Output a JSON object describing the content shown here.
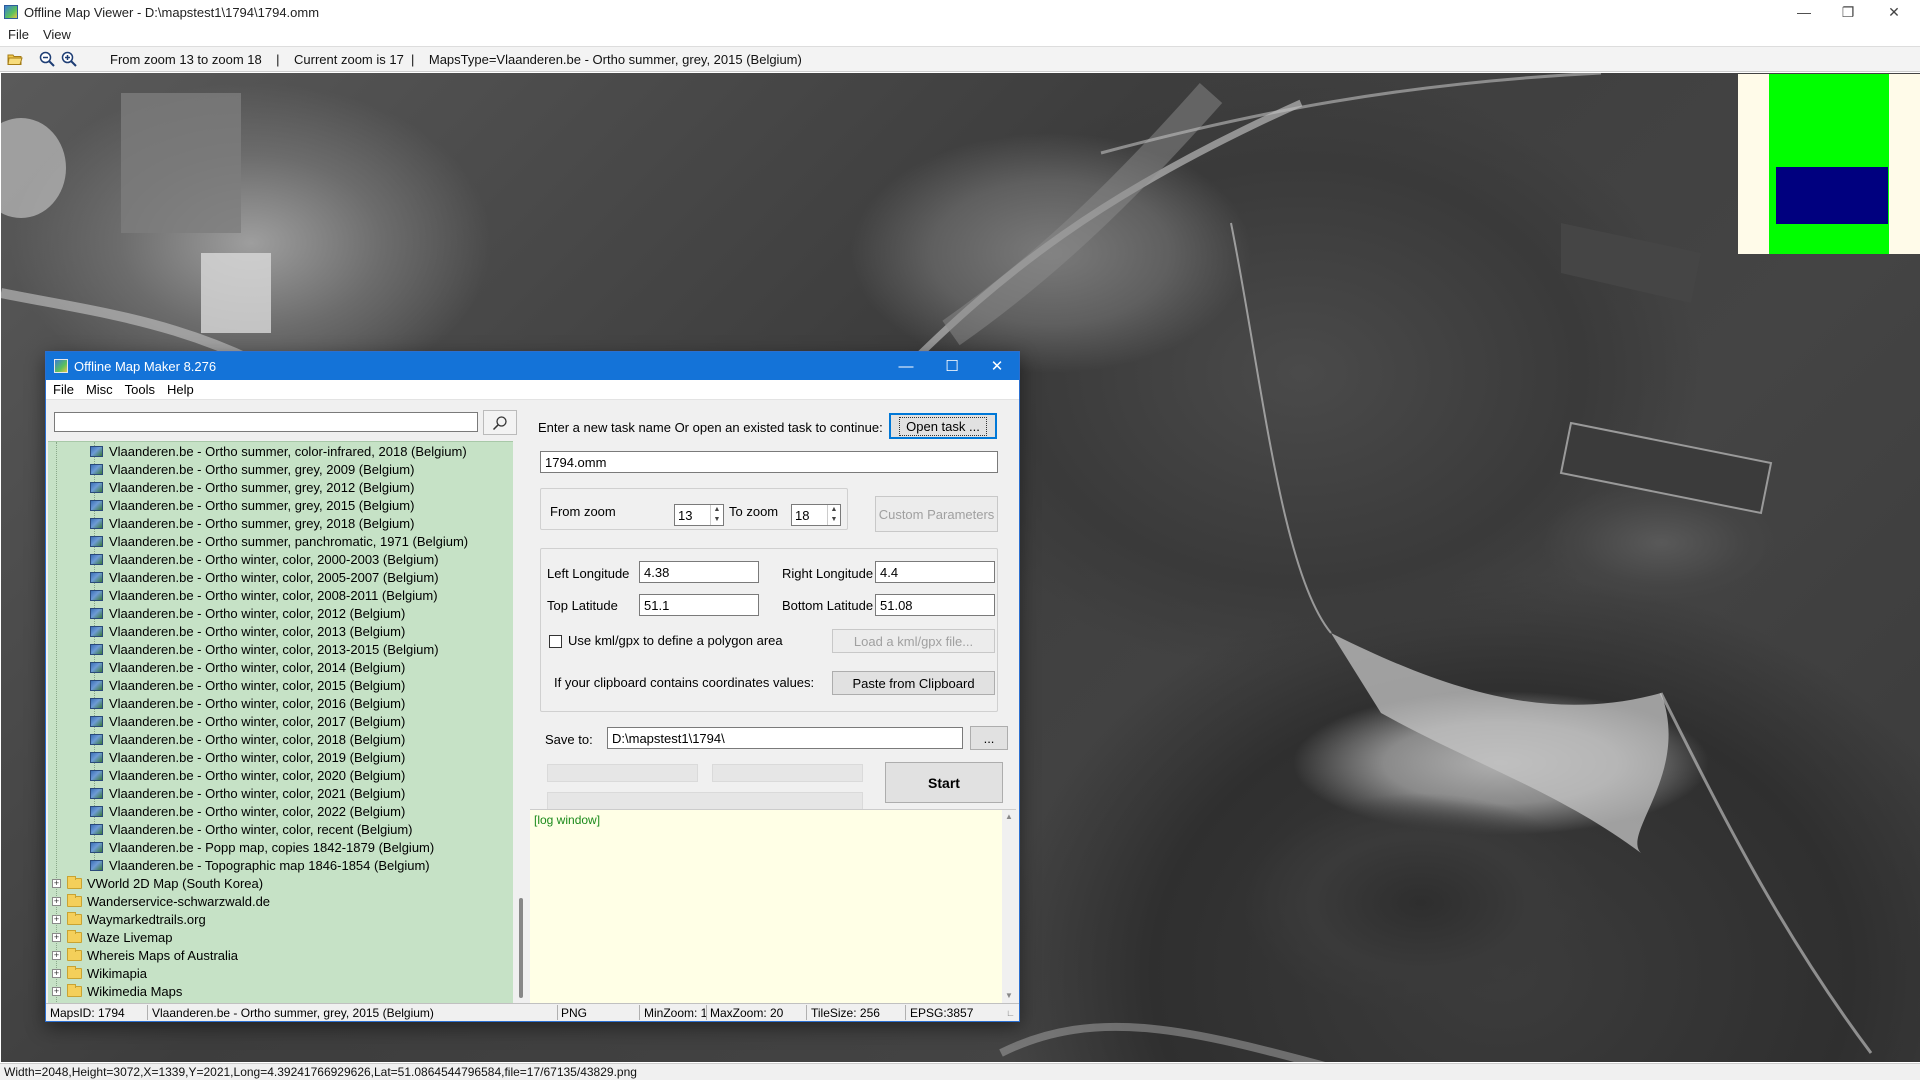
{
  "viewer": {
    "title": "Offline Map Viewer - D:\\mapstest1\\1794\\1794.omm",
    "menu": [
      "File",
      "View"
    ],
    "toolbar_info": "From zoom 13 to zoom 18    |    Current zoom is 17  |    MapsType=Vlaanderen.be - Ortho summer, grey, 2015 (Belgium)",
    "status": "Width=2048,Height=3072,X=1339,Y=2021,Long=4.39241766929626,Lat=51.0864544796584,file=17/67135/43829.png",
    "icons": [
      "open-folder-icon",
      "zoom-out-icon",
      "zoom-in-icon",
      "minimize-icon",
      "restore-icon",
      "close-icon"
    ]
  },
  "dialog": {
    "title": "Offline Map Maker 8.276",
    "menu": [
      "File",
      "Misc",
      "Tools",
      "Help"
    ],
    "search": {
      "value": "",
      "placeholder": ""
    },
    "tree": {
      "map_items": [
        "Vlaanderen.be - Ortho summer, color-infrared, 2018 (Belgium)",
        "Vlaanderen.be - Ortho summer, grey, 2009 (Belgium)",
        "Vlaanderen.be - Ortho summer, grey, 2012 (Belgium)",
        "Vlaanderen.be - Ortho summer, grey, 2015 (Belgium)",
        "Vlaanderen.be - Ortho summer, grey, 2018 (Belgium)",
        "Vlaanderen.be - Ortho summer, panchromatic, 1971 (Belgium)",
        "Vlaanderen.be - Ortho winter, color, 2000-2003 (Belgium)",
        "Vlaanderen.be - Ortho winter, color, 2005-2007 (Belgium)",
        "Vlaanderen.be - Ortho winter, color, 2008-2011 (Belgium)",
        "Vlaanderen.be - Ortho winter, color, 2012 (Belgium)",
        "Vlaanderen.be - Ortho winter, color, 2013 (Belgium)",
        "Vlaanderen.be - Ortho winter, color, 2013-2015 (Belgium)",
        "Vlaanderen.be - Ortho winter, color, 2014 (Belgium)",
        "Vlaanderen.be - Ortho winter, color, 2015 (Belgium)",
        "Vlaanderen.be - Ortho winter, color, 2016 (Belgium)",
        "Vlaanderen.be - Ortho winter, color, 2017 (Belgium)",
        "Vlaanderen.be - Ortho winter, color, 2018 (Belgium)",
        "Vlaanderen.be - Ortho winter, color, 2019 (Belgium)",
        "Vlaanderen.be - Ortho winter, color, 2020 (Belgium)",
        "Vlaanderen.be - Ortho winter, color, 2021 (Belgium)",
        "Vlaanderen.be - Ortho winter, color, 2022 (Belgium)",
        "Vlaanderen.be - Ortho winter, color, recent (Belgium)",
        "Vlaanderen.be - Popp map, copies 1842-1879 (Belgium)",
        "Vlaanderen.be - Topographic map 1846-1854 (Belgium)"
      ],
      "folders": [
        "VWorld 2D Map (South Korea)",
        "Wanderservice-schwarzwald.de",
        "Waymarkedtrails.org",
        "Waze Livemap",
        "Whereis Maps of Australia",
        "Wikimapia",
        "Wikimedia Maps"
      ]
    },
    "task_prompt": "Enter a new task name Or open an existed task to continue:",
    "open_task_label": "Open task ...",
    "task_name": "1794.omm",
    "from_zoom_label": "From zoom",
    "from_zoom": "13",
    "to_zoom_label": "To zoom",
    "to_zoom": "18",
    "custom_params_label": "Custom Parameters",
    "left_lon_label": "Left Longitude",
    "left_lon": "4.38",
    "right_lon_label": "Right Longitude",
    "right_lon": "4.4",
    "top_lat_label": "Top Latitude",
    "top_lat": "51.1",
    "bottom_lat_label": "Bottom Latitude",
    "bottom_lat": "51.08",
    "kml_label": "Use kml/gpx to define a polygon area",
    "kml_checked": false,
    "load_kml_label": "Load a kml/gpx file...",
    "clipboard_prompt": "If your clipboard contains coordinates values:",
    "paste_label": "Paste from Clipboard",
    "save_to_label": "Save to:",
    "save_to": "D:\\mapstest1\\1794\\",
    "browse_label": "...",
    "start_label": "Start",
    "log_text": "[log window]",
    "status": {
      "maps_id": "MapsID: 1794",
      "maps_name": "Vlaanderen.be - Ortho summer, grey, 2015 (Belgium)",
      "format": "PNG",
      "min_zoom": "MinZoom: 1",
      "max_zoom": "MaxZoom: 20",
      "tile_size": "TileSize: 256",
      "epsg": "EPSG:3857"
    }
  },
  "colors": {
    "dialog_title": "#1473d8",
    "tree_bg": "#c6e2c6",
    "log_bg": "#ffffe6",
    "minimap_bg": "#fffbe9",
    "minimap_green": "#00ff00",
    "minimap_blue": "#00007f"
  }
}
